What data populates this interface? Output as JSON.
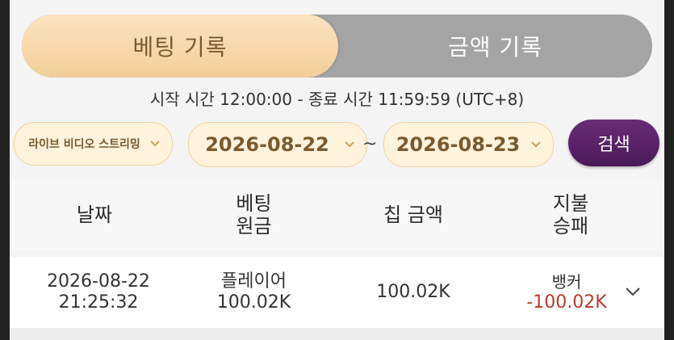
{
  "tabs": {
    "bet_history": "베팅 기록",
    "amount_history": "금액 기록"
  },
  "time_note": "시작 시간 12:00:00 - 종료 시간 11:59:59 (UTC+8)",
  "filters": {
    "game_select": "라이브 비디오 스트리밍",
    "date_start": "2026-08-22",
    "date_separator": "~",
    "date_end": "2026-08-23",
    "search_label": "검색"
  },
  "table": {
    "headers": {
      "date": "날짜",
      "bet_line1": "베팅",
      "bet_line2": "원금",
      "chip_amount": "칩 금액",
      "pay_line1": "지불",
      "pay_line2": "승패"
    },
    "rows": [
      {
        "date": "2026-08-22",
        "time": "21:25:32",
        "bet_type": "플레이어",
        "bet_amount": "100.02K",
        "chip_amount": "100.02K",
        "result": "뱅커",
        "payout": "-100.02K"
      }
    ]
  },
  "colors": {
    "tab_active_bg": "#f2cf9a",
    "tab_inactive_bg": "#a4a4a4",
    "pill_bg": "#fff3dc",
    "pill_text": "#7b5a2e",
    "search_bg": "#5a2266",
    "loss_text": "#c0392b"
  },
  "icons": {
    "dropdown": "chevron-down-icon",
    "expand_row": "chevron-down-icon"
  }
}
